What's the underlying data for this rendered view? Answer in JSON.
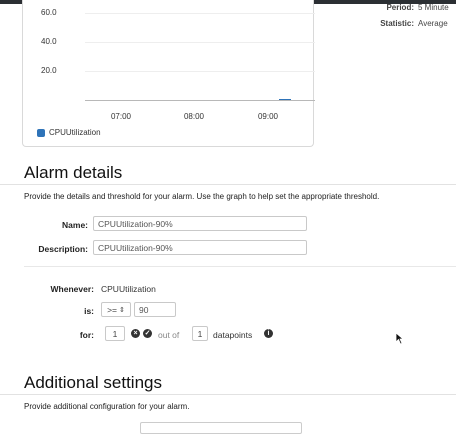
{
  "chart": {
    "y_ticks": [
      "60.0",
      "40.0",
      "20.0"
    ],
    "x_ticks": [
      "07:00",
      "08:00",
      "09:00"
    ],
    "legend_label": "CPUUtilization",
    "series_color": "#2e73b8"
  },
  "info": {
    "period_label": "Period:",
    "period_value": "5 Minute",
    "statistic_label": "Statistic:",
    "statistic_value": "Average"
  },
  "alarm_details": {
    "title": "Alarm details",
    "hint": "Provide the details and threshold for your alarm. Use the graph to help set the appropriate threshold.",
    "name_label": "Name:",
    "name_value": "CPUUtilization-90%",
    "description_label": "Description:",
    "description_value": "CPUUtilization-90%"
  },
  "condition": {
    "whenever_label": "Whenever:",
    "whenever_value": "CPUUtilization",
    "is_label": "is:",
    "operator": ">=",
    "threshold": "90",
    "for_label": "for:",
    "periods": "1",
    "out_of_text": "out of",
    "datapoints": "1",
    "datapoints_text": "datapoints"
  },
  "additional_settings": {
    "title": "Additional settings",
    "hint": "Provide additional configuration for your alarm."
  }
}
